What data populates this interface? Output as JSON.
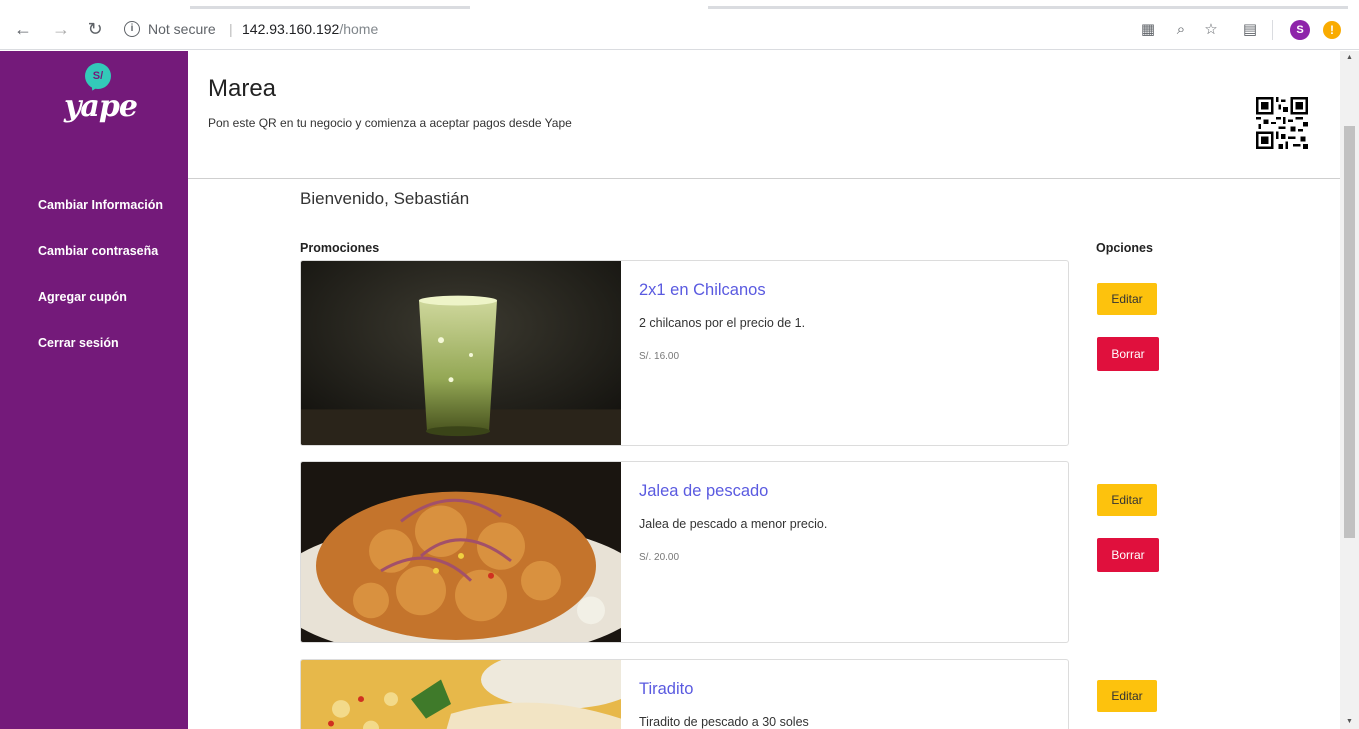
{
  "browser": {
    "security_label": "Not secure",
    "separator": "|",
    "url_host": "142.93.160.192",
    "url_path": "/home",
    "profile_initial": "S",
    "update_badge": "!"
  },
  "sidebar": {
    "logo_bubble": "S/",
    "logo_text": "yape",
    "items": [
      {
        "label": "Cambiar Información"
      },
      {
        "label": "Cambiar contraseña"
      },
      {
        "label": "Agregar cupón"
      },
      {
        "label": "Cerrar sesión"
      }
    ]
  },
  "header": {
    "business_name": "Marea",
    "subtitle": "Pon este QR en tu negocio y comienza a aceptar pagos desde Yape"
  },
  "main": {
    "welcome": "Bienvenido, Sebastián",
    "col_promotions": "Promociones",
    "col_options": "Opciones",
    "edit_label": "Editar",
    "delete_label": "Borrar",
    "promotions": [
      {
        "title": "2x1 en Chilcanos",
        "description": "2 chilcanos por el precio de 1.",
        "price": "S/. 16.00"
      },
      {
        "title": "Jalea de pescado",
        "description": "Jalea de pescado a menor precio.",
        "price": "S/. 20.00"
      },
      {
        "title": "Tiradito",
        "description": "Tiradito de pescado a 30 soles",
        "price": ""
      }
    ]
  },
  "colors": {
    "sidebar": "#741a7a",
    "edit_button": "#fdc20d",
    "delete_button": "#e0103d",
    "title_link": "#5a5ae0"
  }
}
